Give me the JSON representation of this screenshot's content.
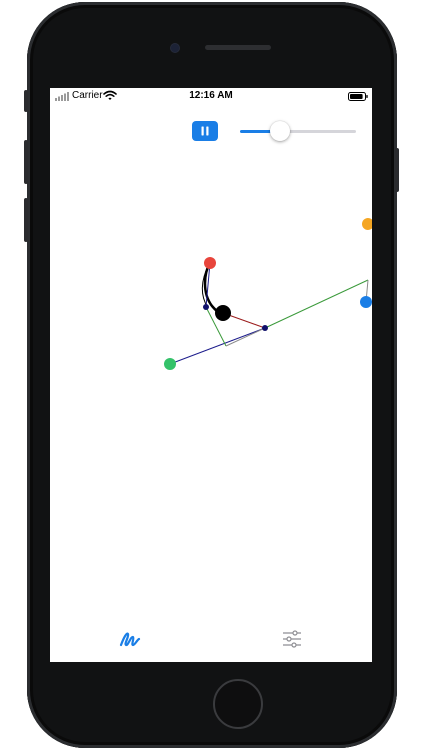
{
  "status_bar": {
    "carrier": "Carrier",
    "time": "12:16 AM",
    "battery_level": 0.9
  },
  "controls": {
    "play_state": "paused",
    "pause_icon": "pause-icon",
    "speed_slider_value": 0.31
  },
  "tabs": [
    {
      "icon": "scribble-icon",
      "selected": true
    },
    {
      "icon": "sliders-icon",
      "selected": false
    }
  ],
  "colors": {
    "accent": "#1a7ee6",
    "ball_red": "#e8453c",
    "ball_orange": "#f5a623",
    "ball_blue": "#1a7ee6",
    "ball_green": "#34c26a",
    "ball_black": "#000000",
    "joint_navy": "#10106b",
    "link_red": "#9b1c1c",
    "link_green": "#3b9a3b",
    "link_navy": "#1c1c8c",
    "link_grey": "#8a8a8a"
  }
}
